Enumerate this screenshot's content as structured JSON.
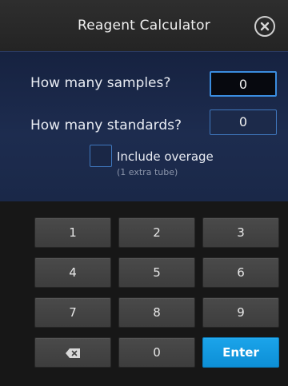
{
  "window": {
    "title": "Reagent Calculator",
    "close_icon": "close-circle-icon"
  },
  "form": {
    "samples_label": "How many samples?",
    "samples_value": "0",
    "standards_label": "How many standards?",
    "standards_value": "0",
    "overage_label": "Include overage",
    "overage_sublabel": "(1 extra tube)",
    "overage_checked": false
  },
  "keypad": {
    "keys": [
      "1",
      "2",
      "3",
      "4",
      "5",
      "6",
      "7",
      "8",
      "9"
    ],
    "backspace_icon": "backspace-icon",
    "zero": "0",
    "enter": "Enter"
  },
  "colors": {
    "accent": "#1ba4ea",
    "panel_bg": "#1d2c4f",
    "field_border": "#3f77bd"
  }
}
